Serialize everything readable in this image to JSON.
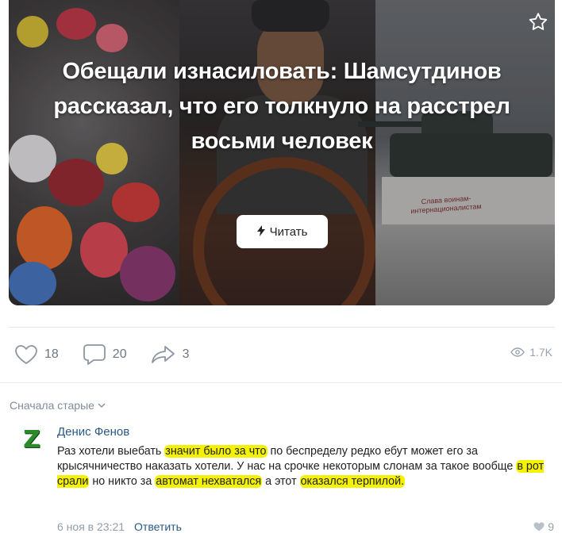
{
  "post": {
    "title": "Обещали изнасиловать: Шамсутдинов рассказал, что его толкнуло на расстрел восьми человек",
    "read_button_label": "Читать",
    "monument_text": "Слава воинам-интернационалистам",
    "likes": "18",
    "comments": "20",
    "shares": "3",
    "views": "1.7K"
  },
  "comments_section": {
    "sort_label": "Сначала старые",
    "comment": {
      "avatar_letter": "Z",
      "author": "Денис Фенов",
      "text_parts": [
        "Раз хотели выебать ",
        "значит было за что",
        " по беспределу редко ебут может его за крысячничество наказать хотели. У нас на срочке некоторым слонам за такое вообще ",
        "в рот срали",
        " но никто за ",
        "автомат нехватался",
        " а этот ",
        "оказался терпилой."
      ],
      "date": "6 ноя в 23:21",
      "reply_label": "Ответить",
      "likes": "9"
    }
  },
  "colors": {
    "link": "#2a5885",
    "muted": "#818c99",
    "highlight": "#f4f103",
    "avatar_green": "#2c8a2b"
  }
}
